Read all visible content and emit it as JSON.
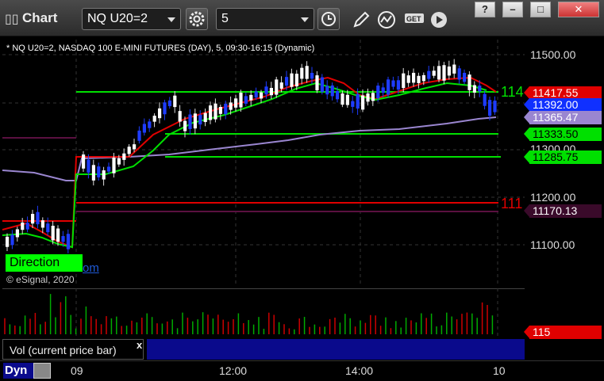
{
  "titlebar": {
    "title": "Chart",
    "symbol": "NQ U20=2",
    "interval": "5",
    "window_buttons": [
      "?",
      "–",
      "□",
      "✕"
    ]
  },
  "chart": {
    "caption": "* NQ U20=2, NASDAQ 100 E-MINI FUTURES (DAY), 5, 09:30-16:15 (Dynamic)",
    "copyright": "© eSignal, 2020",
    "direction_label": "Direction",
    "direction_tail": "om",
    "line_label_upper": "114",
    "line_label_lower": "111",
    "y_ticks": [
      "11500.00",
      "11300.00",
      "11200.00",
      "11100.00"
    ],
    "price_tags": [
      {
        "value": "11417.55",
        "bg": "#e00000",
        "fg": "#ffffff"
      },
      {
        "value": "11392.00",
        "bg": "#1030ff",
        "fg": "#ffffff"
      },
      {
        "value": "11365.47",
        "bg": "#9a86d0",
        "fg": "#ffffff"
      },
      {
        "value": "11333.50",
        "bg": "#00e000",
        "fg": "#000000"
      },
      {
        "value": "11285.75",
        "bg": "#00e000",
        "fg": "#000000"
      },
      {
        "value": "11170.13",
        "bg": "#3a0a2a",
        "fg": "#ffffff"
      }
    ],
    "vol_tag": "115",
    "vol_legend": "Vol (current price bar)",
    "vol_close": "x"
  },
  "bottom": {
    "dyn": "Dyn",
    "time_labels": [
      "09",
      "12:00",
      "14:00",
      "10"
    ]
  },
  "colors": {
    "up_candle": "#ffffff",
    "down_candle": "#1e3cff",
    "resistance": "#00e000",
    "support": "#e00000",
    "ma_fast": "#00e000",
    "ma_slow": "#9a86d0",
    "ma_red": "#e00000",
    "volume_up": "#00aa00",
    "volume_down": "#cc0000"
  }
}
